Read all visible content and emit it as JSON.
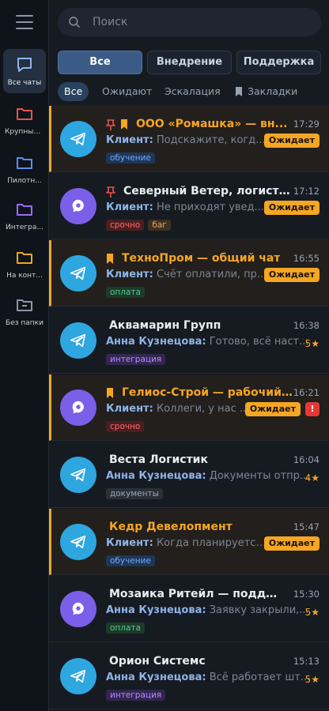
{
  "sidebar": {
    "items": [
      {
        "label": "Все чаты",
        "icon": "chat-bubble-icon",
        "color": "#8fb4e8",
        "active": true
      },
      {
        "label": "Крупные...",
        "icon": "folder-icon",
        "color": "#e5534b"
      },
      {
        "label": "Пилотн...",
        "icon": "folder-icon",
        "color": "#5b8def"
      },
      {
        "label": "Интегра...",
        "icon": "folder-icon",
        "color": "#9b6bf2"
      },
      {
        "label": "На конт...",
        "icon": "folder-icon",
        "color": "#f5a623"
      },
      {
        "label": "Без папки",
        "icon": "folder-minus-icon",
        "color": "#8b96a5"
      }
    ]
  },
  "search": {
    "placeholder": "Поиск"
  },
  "tabs": [
    "Все",
    "Внедрение",
    "Поддержка"
  ],
  "filters": [
    "Все",
    "Ожидают",
    "Эскалация",
    "Закладки"
  ],
  "chats": [
    {
      "title": "ООО «Ромашка» — вн...",
      "time": "17:29",
      "sender": "Клиент:",
      "message": "Подскажите, когд...",
      "status": "Ожидает",
      "tags": [
        {
          "text": "обучение",
          "color": "blue"
        }
      ],
      "avatar": "telegram",
      "pin": true,
      "bookmark": true,
      "highlight": true
    },
    {
      "title": "Северный Ветер, логистика",
      "time": "17:12",
      "sender": "Клиент:",
      "message": "Не приходят увед...",
      "status": "Ожидает",
      "tags": [
        {
          "text": "срочно",
          "color": "red"
        },
        {
          "text": "баг",
          "color": "brown"
        }
      ],
      "avatar": "max",
      "pin": true,
      "bookmark": false,
      "highlight": false
    },
    {
      "title": "ТехноПром — общий чат",
      "time": "16:55",
      "sender": "Клиент:",
      "message": "Счёт оплатили, пр...",
      "status": "Ожидает",
      "tags": [
        {
          "text": "оплата",
          "color": "green"
        }
      ],
      "avatar": "telegram",
      "pin": false,
      "bookmark": true,
      "highlight": true
    },
    {
      "title": "Аквамарин Групп",
      "time": "16:38",
      "sender": "Анна Кузнецова:",
      "message": "Готово, всё наст...",
      "rating": "5★",
      "tags": [
        {
          "text": "интеграция",
          "color": "purple"
        }
      ],
      "avatar": "telegram",
      "highlight": false
    },
    {
      "title": "Гелиос-Строй — рабочий ...",
      "time": "16:21",
      "sender": "Клиент:",
      "message": "Коллеги, у нас ...",
      "status": "Ожидает",
      "alert": "!",
      "tags": [
        {
          "text": "срочно",
          "color": "red"
        }
      ],
      "avatar": "max",
      "pin": false,
      "bookmark": true,
      "highlight": true
    },
    {
      "title": "Веста Логистик",
      "time": "16:04",
      "sender": "Анна Кузнецова:",
      "message": "Документы отпр...",
      "rating": "4★",
      "tags": [
        {
          "text": "документы",
          "color": "gray"
        }
      ],
      "avatar": "telegram",
      "highlight": false
    },
    {
      "title": "Кедр Девелопмент",
      "time": "15:47",
      "sender": "Клиент:",
      "message": "Когда планируется...",
      "status": "Ожидает",
      "tags": [
        {
          "text": "обучение",
          "color": "blue"
        }
      ],
      "avatar": "telegram",
      "highlight": true
    },
    {
      "title": "Мозаика Ритейл — поддержка",
      "time": "15:30",
      "sender": "Анна Кузнецова:",
      "message": "Заявку закрыли,...",
      "rating": "5★",
      "tags": [
        {
          "text": "оплата",
          "color": "green"
        }
      ],
      "avatar": "max",
      "highlight": false
    },
    {
      "title": "Орион Системс",
      "time": "15:13",
      "sender": "Анна Кузнецова:",
      "message": "Всё работает шт...",
      "rating": "5★",
      "tags": [
        {
          "text": "интеграция",
          "color": "purple"
        }
      ],
      "avatar": "telegram",
      "highlight": false
    }
  ]
}
